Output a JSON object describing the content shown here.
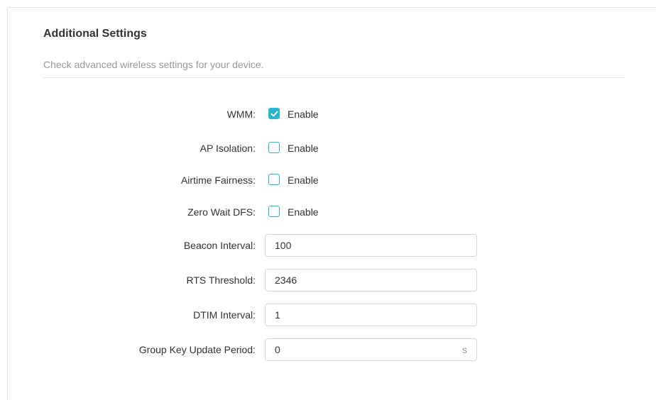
{
  "section": {
    "title": "Additional Settings",
    "description": "Check advanced wireless settings for your device."
  },
  "fields": {
    "wmm": {
      "label": "WMM:",
      "option": "Enable",
      "checked": true
    },
    "ap_isolation": {
      "label": "AP Isolation:",
      "option": "Enable",
      "checked": false
    },
    "airtime_fairness": {
      "label": "Airtime Fairness:",
      "option": "Enable",
      "checked": false
    },
    "zero_wait_dfs": {
      "label": "Zero Wait DFS:",
      "option": "Enable",
      "checked": false
    },
    "beacon_interval": {
      "label": "Beacon Interval:",
      "value": "100"
    },
    "rts_threshold": {
      "label": "RTS Threshold:",
      "value": "2346"
    },
    "dtim_interval": {
      "label": "DTIM Interval:",
      "value": "1"
    },
    "group_key_update_period": {
      "label": "Group Key Update Period:",
      "value": "0",
      "unit": "s"
    }
  },
  "colors": {
    "accent": "#2bb5cf",
    "text": "#333333",
    "muted": "#999999",
    "border": "#d9d9d9"
  },
  "icons": {
    "checkmark": "checkmark-icon"
  }
}
